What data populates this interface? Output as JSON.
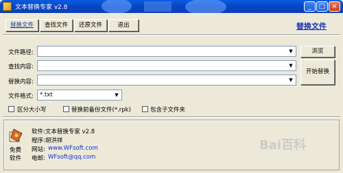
{
  "window": {
    "title": "文本替换专家 v2.8"
  },
  "toolbar": {
    "replace_label": "替换文件",
    "search_label": "查找文件",
    "restore_label": "还原文件",
    "exit_label": "退出",
    "header_title": "替换文件"
  },
  "form": {
    "path_label": "文件路径:",
    "path_value": "",
    "find_label": "查找内容:",
    "find_value": "",
    "replace_label": "替换内容:",
    "replace_value": "",
    "format_label": "文件格式:",
    "format_value": "*.txt",
    "browse_label": "浏览",
    "start_label": "开始替换",
    "case_label": "区分大小写",
    "backup_label": "替换前备份文件(*.rpk)",
    "subfolder_label": "包含子文件夹"
  },
  "about": {
    "free_label_1": "免费",
    "free_label_2": "软件",
    "software": "软件:文本替换专家 v2.8",
    "author": "程序:胡洪祥",
    "website_label": "网站:",
    "website": "www.WFsoft.com",
    "email_label": "电邮:",
    "email": "WFsoft@qq.com"
  },
  "watermark": "Bai百科"
}
